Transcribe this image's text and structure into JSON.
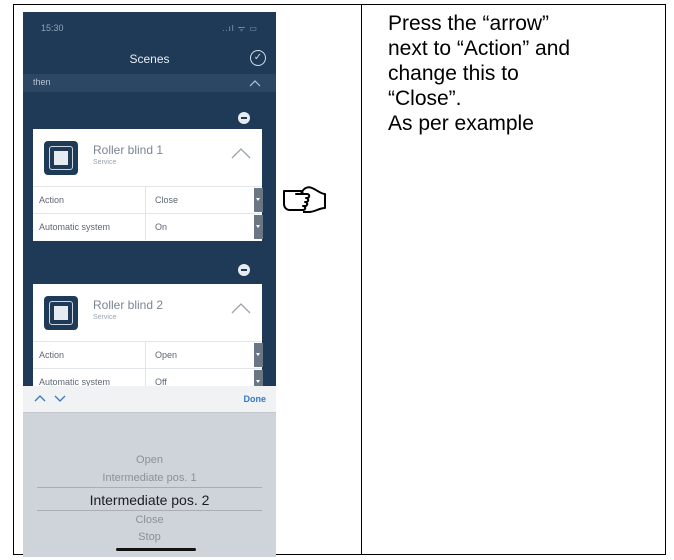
{
  "phone": {
    "status": {
      "time": "15:30",
      "icons": "..ıl ᯤ ▭"
    },
    "nav": {
      "title": "Scenes",
      "confirm_icon": "check-circle-icon"
    },
    "then_bar": {
      "label": "then"
    },
    "devices": [
      {
        "name": "Roller blind 1",
        "type": "Service",
        "rows": [
          {
            "label": "Action",
            "value": "Close"
          },
          {
            "label": "Automatic system",
            "value": "On"
          }
        ]
      },
      {
        "name": "Roller blind 2",
        "type": "Service",
        "rows": [
          {
            "label": "Action",
            "value": "Open"
          },
          {
            "label": "Automatic system",
            "value": "Off"
          }
        ]
      }
    ],
    "picker": {
      "done_label": "Done",
      "options": [
        "Open",
        "Intermediate pos. 1",
        "Intermediate pos. 2",
        "Close",
        "Stop"
      ],
      "selected": "Intermediate pos. 2"
    }
  },
  "instruction": {
    "lines": [
      "Press the “arrow”",
      "next to “Action” and",
      "change this to",
      "“Close”.",
      "As per example"
    ]
  },
  "colors": {
    "app_background": "#1f3a57",
    "card": "#ffffff",
    "picker": "#cfd3da",
    "done": "#3478c6"
  }
}
